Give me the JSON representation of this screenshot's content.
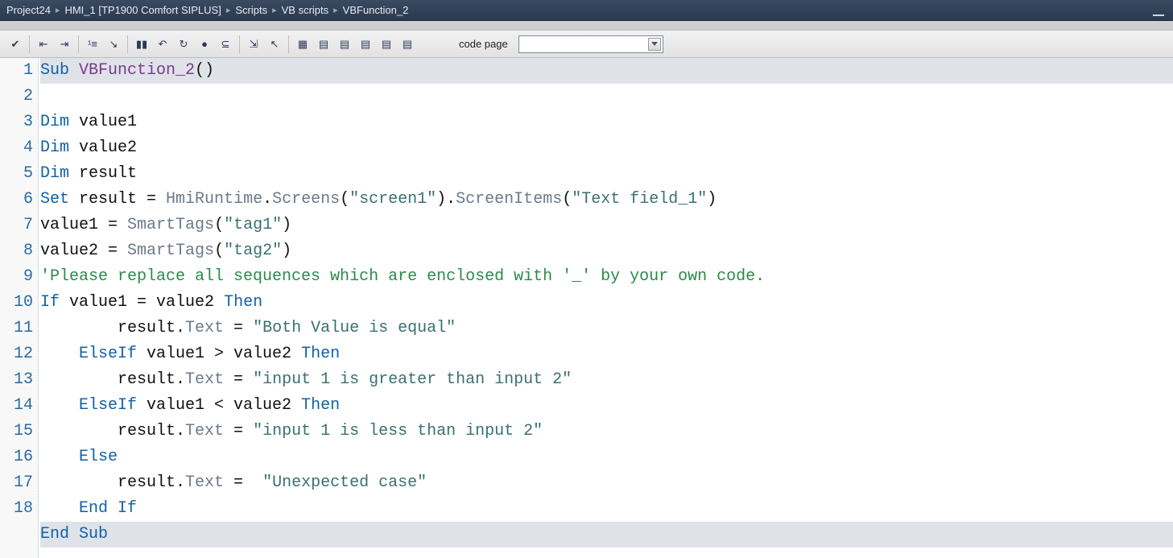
{
  "breadcrumbs": {
    "items": [
      "Project24",
      "HMI_1 [TP1900 Comfort SIPLUS]",
      "Scripts",
      "VB scripts",
      "VBFunction_2"
    ]
  },
  "toolbar": {
    "buttons": [
      "syntax-check",
      "sep",
      "indent-in",
      "indent-out",
      "sep",
      "toggle-outline",
      "toggle-signature",
      "sep",
      "pause",
      "step-into",
      "step-over",
      "toggle-breakpoint",
      "step-condition",
      "sep",
      "goto-def",
      "pointer",
      "sep",
      "object-browser",
      "script-1",
      "script-2",
      "script-3",
      "script-4",
      "script-5"
    ],
    "codepage_label": "code page",
    "codepage_value": ""
  },
  "code": {
    "lines": [
      {
        "n": 1,
        "hl": true,
        "tokens": [
          [
            "kw",
            "Sub "
          ],
          [
            "fn",
            "VBFunction_2"
          ],
          [
            "txt",
            "()"
          ]
        ]
      },
      {
        "n": 2,
        "hl": false,
        "tokens": [
          [
            "kw",
            "Dim"
          ],
          [
            "txt",
            " value1"
          ]
        ]
      },
      {
        "n": 3,
        "hl": false,
        "tokens": [
          [
            "kw",
            "Dim"
          ],
          [
            "txt",
            " value2"
          ]
        ]
      },
      {
        "n": 4,
        "hl": false,
        "tokens": [
          [
            "kw",
            "Dim"
          ],
          [
            "txt",
            " result"
          ]
        ]
      },
      {
        "n": 5,
        "hl": false,
        "tokens": [
          [
            "kw",
            "Set"
          ],
          [
            "txt",
            " result = "
          ],
          [
            "obj",
            "HmiRuntime"
          ],
          [
            "txt",
            "."
          ],
          [
            "obj",
            "Screens"
          ],
          [
            "txt",
            "("
          ],
          [
            "str",
            "\"screen1\""
          ],
          [
            "txt",
            ")."
          ],
          [
            "obj",
            "ScreenItems"
          ],
          [
            "txt",
            "("
          ],
          [
            "str",
            "\"Text field_1\""
          ],
          [
            "txt",
            ")"
          ]
        ]
      },
      {
        "n": 6,
        "hl": false,
        "tokens": [
          [
            "txt",
            "value1 = "
          ],
          [
            "obj",
            "SmartTags"
          ],
          [
            "txt",
            "("
          ],
          [
            "str",
            "\"tag1\""
          ],
          [
            "txt",
            ")"
          ]
        ]
      },
      {
        "n": 7,
        "hl": false,
        "tokens": [
          [
            "txt",
            "value2 = "
          ],
          [
            "obj",
            "SmartTags"
          ],
          [
            "txt",
            "("
          ],
          [
            "str",
            "\"tag2\""
          ],
          [
            "txt",
            ")"
          ]
        ]
      },
      {
        "n": 8,
        "hl": false,
        "tokens": [
          [
            "cmt",
            "'Please replace all sequences which are enclosed with '_' by your own code."
          ]
        ]
      },
      {
        "n": 9,
        "hl": false,
        "tokens": [
          [
            "kw",
            "If"
          ],
          [
            "txt",
            " value1 = value2 "
          ],
          [
            "kw",
            "Then"
          ]
        ]
      },
      {
        "n": 10,
        "hl": false,
        "tokens": [
          [
            "txt",
            "        result."
          ],
          [
            "obj",
            "Text"
          ],
          [
            "txt",
            " = "
          ],
          [
            "str",
            "\"Both Value is equal\""
          ]
        ]
      },
      {
        "n": 11,
        "hl": false,
        "tokens": [
          [
            "txt",
            "    "
          ],
          [
            "kw",
            "ElseIf"
          ],
          [
            "txt",
            " value1 > value2 "
          ],
          [
            "kw",
            "Then"
          ]
        ]
      },
      {
        "n": 12,
        "hl": false,
        "tokens": [
          [
            "txt",
            "        result."
          ],
          [
            "obj",
            "Text"
          ],
          [
            "txt",
            " = "
          ],
          [
            "str",
            "\"input 1 is greater than input 2\""
          ]
        ]
      },
      {
        "n": 13,
        "hl": false,
        "tokens": [
          [
            "txt",
            "    "
          ],
          [
            "kw",
            "ElseIf"
          ],
          [
            "txt",
            " value1 < value2 "
          ],
          [
            "kw",
            "Then"
          ]
        ]
      },
      {
        "n": 14,
        "hl": false,
        "tokens": [
          [
            "txt",
            "        result."
          ],
          [
            "obj",
            "Text"
          ],
          [
            "txt",
            " = "
          ],
          [
            "str",
            "\"input 1 is less than input 2\""
          ]
        ]
      },
      {
        "n": 15,
        "hl": false,
        "tokens": [
          [
            "txt",
            "    "
          ],
          [
            "kw",
            "Else"
          ]
        ]
      },
      {
        "n": 16,
        "hl": false,
        "tokens": [
          [
            "txt",
            "        result."
          ],
          [
            "obj",
            "Text"
          ],
          [
            "txt",
            " =  "
          ],
          [
            "str",
            "\"Unexpected case\""
          ]
        ]
      },
      {
        "n": 17,
        "hl": false,
        "tokens": [
          [
            "txt",
            "    "
          ],
          [
            "kw",
            "End If"
          ]
        ]
      },
      {
        "n": 18,
        "hl": true,
        "tokens": [
          [
            "kw",
            "End Sub"
          ]
        ]
      }
    ]
  }
}
